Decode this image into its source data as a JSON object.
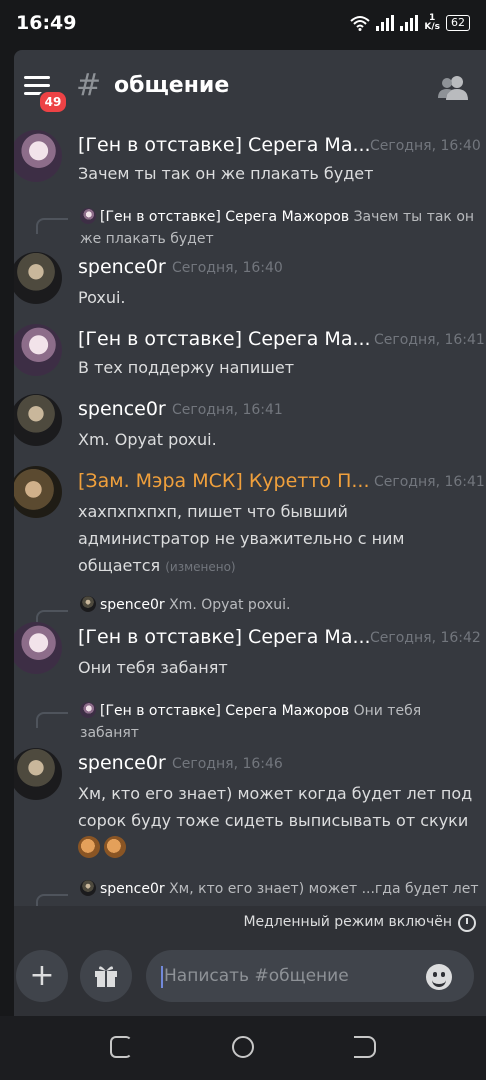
{
  "status": {
    "time": "16:49",
    "speed_value": "1",
    "speed_unit": "K/s",
    "battery": "62"
  },
  "header": {
    "badge": "49",
    "hash": "#",
    "channel": "общение"
  },
  "messages": [
    {
      "name": "[Ген в отставке] Серега Ма...",
      "time": "Сегодня, 16:40",
      "text": "Зачем ты так он же плакать будет"
    },
    {
      "reply_name": "[Ген в отставке] Серега Мажоров",
      "reply_text": "Зачем ты так он же плакать будет"
    },
    {
      "name": "spence0r",
      "time": "Сегодня, 16:40",
      "text": "Poxui."
    },
    {
      "name": "[Ген в отставке] Серега Ма...",
      "time": "Сегодня, 16:41",
      "text": "В тех поддержу напишет"
    },
    {
      "name": "spence0r",
      "time": "Сегодня, 16:41",
      "text": "Хm. Opyat poxui."
    },
    {
      "name": "[Зам. Мэра МСК] Куретто П...",
      "time": "Сегодня, 16:41",
      "text": "хахпхпхпхп, пишет что бывший администратор не уважительно с ним общается",
      "edited": "(изменено)"
    },
    {
      "reply_name": "spence0r",
      "reply_text": "Хm. Opyat poxui."
    },
    {
      "name": "[Ген в отставке] Серега Ма...",
      "time": "Сегодня, 16:42",
      "text": "Они тебя забанят"
    },
    {
      "reply_name": "[Ген в отставке] Серега Мажоров",
      "reply_text": "Они тебя забанят"
    },
    {
      "name": "spence0r",
      "time": "Сегодня, 16:46",
      "text": "Хм, кто его знает) может когда будет лет под сорок буду тоже сидеть выписывать от скуки"
    },
    {
      "reply_name": "spence0r",
      "reply_text": "Хм, кто его знает) может ...гда будет лет"
    }
  ],
  "slowmode": "Медленный режим включён",
  "composer": {
    "placeholder": "Написать #общение",
    "plus": "+"
  },
  "colors": {
    "background": "#36393f",
    "orange_role": "#f0a03c",
    "badge": "#ed4245"
  },
  "icons": [
    "menu-icon",
    "members-icon",
    "gift-icon",
    "emoji-icon",
    "slowmode-timer-icon"
  ]
}
